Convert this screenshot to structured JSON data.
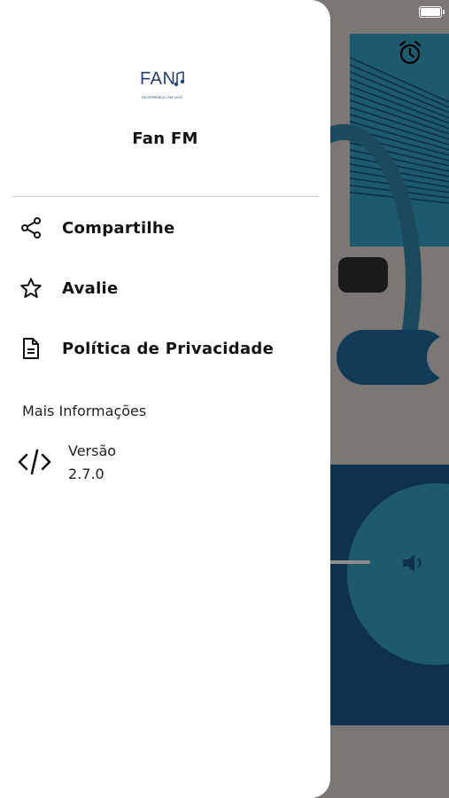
{
  "drawer": {
    "logo": {
      "text": "FAN",
      "tagline": "DE DIFERENÇA COM VOCÊ"
    },
    "title": "Fan FM",
    "items": [
      {
        "label": "Compartilhe",
        "icon": "share-icon"
      },
      {
        "label": "Avalie",
        "icon": "star-icon"
      },
      {
        "label": "Política de Privacidade",
        "icon": "document-icon"
      }
    ],
    "section_title": "Mais Informações",
    "version": {
      "label": "Versão",
      "value": "2.7.0",
      "icon": "code-icon"
    }
  },
  "background": {
    "icons": [
      "alarm-icon",
      "volume-icon",
      "whatsapp-icon"
    ],
    "colors": {
      "teal": "#1e5a6e",
      "navy": "#0e3150",
      "overlay": "#7b7775"
    }
  }
}
